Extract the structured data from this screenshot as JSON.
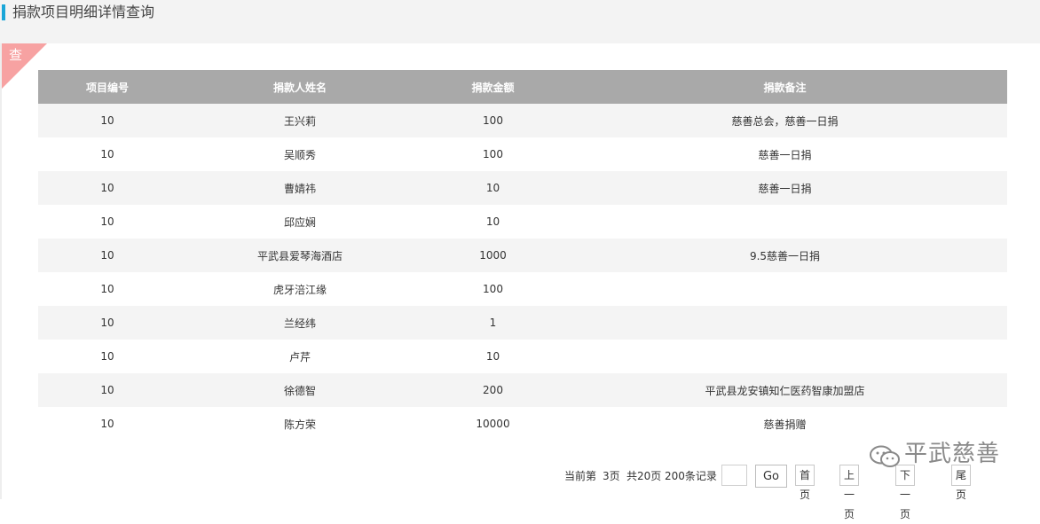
{
  "header": {
    "title": "捐款项目明细详情查询"
  },
  "badge": {
    "label": "查"
  },
  "table": {
    "columns": [
      "项目编号",
      "捐款人姓名",
      "捐款金额",
      "捐款备注"
    ],
    "rows": [
      [
        "10",
        "王兴莉",
        "100",
        "慈善总会，慈善一日捐"
      ],
      [
        "10",
        "吴顺秀",
        "100",
        "慈善一日捐"
      ],
      [
        "10",
        "曹婧祎",
        "10",
        "慈善一日捐"
      ],
      [
        "10",
        "邱应娴",
        "10",
        ""
      ],
      [
        "10",
        "平武县爱琴海酒店",
        "1000",
        "9.5慈善一日捐"
      ],
      [
        "10",
        "虎牙涪江缘",
        "100",
        ""
      ],
      [
        "10",
        "兰经纬",
        "1",
        ""
      ],
      [
        "10",
        "卢芹",
        "10",
        ""
      ],
      [
        "10",
        "徐德智",
        "200",
        "平武县龙安镇知仁医药智康加盟店"
      ],
      [
        "10",
        "陈方荣",
        "10000",
        "慈善捐赠"
      ]
    ]
  },
  "pager": {
    "current_label": "当前第",
    "current_page": "3页",
    "total_pages": "共20页",
    "total_records": "200条记录",
    "page_input_value": "",
    "go_label": "Go",
    "first_label": "首页",
    "prev_label": "上一页",
    "next_label": "下一页",
    "last_label": "尾页"
  },
  "watermark": {
    "text": "平武慈善",
    "icon": "wechat-icon"
  },
  "colors": {
    "accent": "#1aa6d8",
    "header_bg": "#a9a9a9",
    "corner": "#f7a2a2",
    "stripe": "#f4f4f4"
  }
}
